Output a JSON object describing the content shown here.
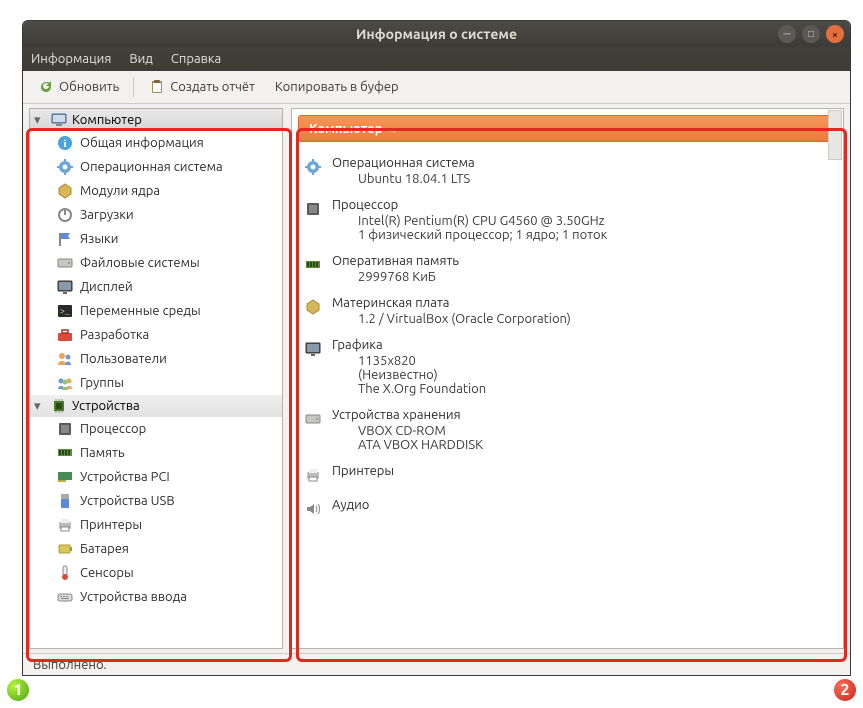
{
  "window": {
    "title": "Информация о системе"
  },
  "menu": {
    "info": "Информация",
    "view": "Вид",
    "help": "Справка"
  },
  "toolbar": {
    "refresh": "Обновить",
    "report": "Создать отчёт",
    "copy": "Копировать в буфер"
  },
  "sidebar": {
    "categories": [
      {
        "id": "computer",
        "label": "Компьютер",
        "icon": "computer-icon",
        "items": [
          {
            "label": "Общая информация",
            "icon": "info-icon"
          },
          {
            "label": "Операционная система",
            "icon": "gear-icon"
          },
          {
            "label": "Модули ядра",
            "icon": "module-icon"
          },
          {
            "label": "Загрузки",
            "icon": "power-icon"
          },
          {
            "label": "Языки",
            "icon": "flag-icon"
          },
          {
            "label": "Файловые системы",
            "icon": "drive-icon"
          },
          {
            "label": "Дисплей",
            "icon": "display-icon"
          },
          {
            "label": "Переменные среды",
            "icon": "terminal-icon"
          },
          {
            "label": "Разработка",
            "icon": "toolbox-icon"
          },
          {
            "label": "Пользователи",
            "icon": "users-icon"
          },
          {
            "label": "Группы",
            "icon": "groups-icon"
          }
        ]
      },
      {
        "id": "devices",
        "label": "Устройства",
        "icon": "chip-icon",
        "items": [
          {
            "label": "Процессор",
            "icon": "cpu-icon"
          },
          {
            "label": "Память",
            "icon": "ram-icon"
          },
          {
            "label": "Устройства PCI",
            "icon": "pci-icon"
          },
          {
            "label": "Устройства USB",
            "icon": "usb-icon"
          },
          {
            "label": "Принтеры",
            "icon": "printer-icon"
          },
          {
            "label": "Батарея",
            "icon": "battery-icon"
          },
          {
            "label": "Сенсоры",
            "icon": "sensor-icon"
          },
          {
            "label": "Устройства ввода",
            "icon": "input-icon"
          }
        ]
      }
    ]
  },
  "main": {
    "header": "Компьютер →",
    "sections": [
      {
        "icon": "gear-icon",
        "title": "Операционная система",
        "lines": [
          "Ubuntu 18.04.1 LTS"
        ]
      },
      {
        "icon": "cpu-icon",
        "title": "Процессор",
        "lines": [
          "Intel(R) Pentium(R) CPU G4560 @ 3.50GHz",
          "1 физический процессор; 1 ядро; 1 поток"
        ]
      },
      {
        "icon": "ram-icon",
        "title": "Оперативная память",
        "lines": [
          "2999768 КиБ"
        ]
      },
      {
        "icon": "module-icon",
        "title": "Материнская плата",
        "lines": [
          "1.2 / VirtualBox (Oracle Corporation)"
        ]
      },
      {
        "icon": "display-icon",
        "title": "Графика",
        "lines": [
          "1135x820",
          "(Неизвестно)",
          "The X.Org Foundation"
        ]
      },
      {
        "icon": "drive-icon",
        "title": "Устройства хранения",
        "lines": [
          "VBOX CD-ROM",
          "ATA VBOX HARDDISK"
        ]
      },
      {
        "icon": "printer-icon",
        "title": "Принтеры",
        "lines": []
      },
      {
        "icon": "audio-icon",
        "title": "Аудио",
        "lines": []
      }
    ]
  },
  "status": "Выполнено.",
  "badges": {
    "one": "1",
    "two": "2"
  }
}
